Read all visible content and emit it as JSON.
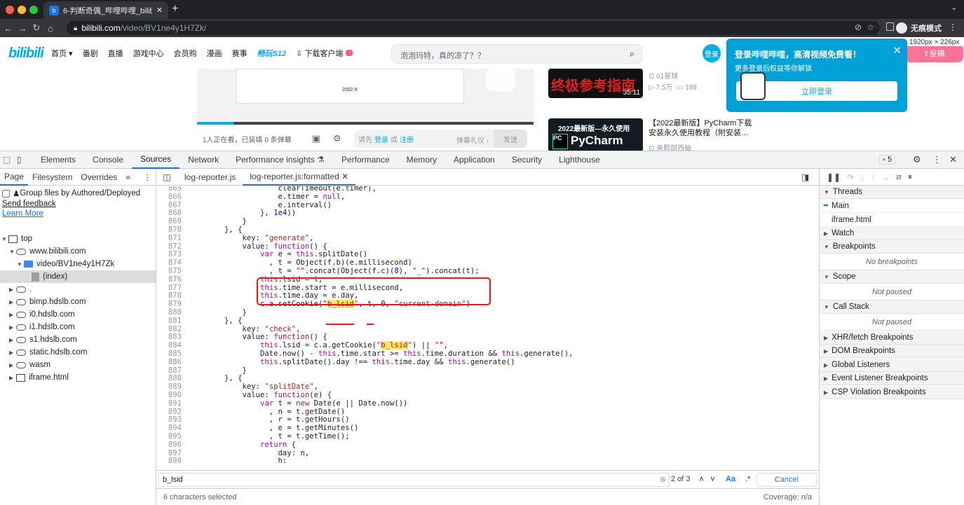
{
  "browser": {
    "tab_title": "6-判断奇偶_哔哩哔哩_bilibili",
    "url_host": "bilibili.com",
    "url_path": "/video/BV1ne4y1H7Zk/",
    "incognito_label": "无痕模式",
    "new_tab_symbol": "+"
  },
  "site": {
    "logo_text": "bilibili",
    "nav": [
      "首页",
      "番剧",
      "直播",
      "游戏中心",
      "会员购",
      "漫画",
      "赛事",
      "畅玩S12",
      "下载客户端"
    ],
    "search_placeholder": "泡泡玛特，真的凉了？？",
    "login_avatar": "登录",
    "upload_label": "投稿",
    "dim_readout": "1920px × 226px",
    "slide_caption": "2002.9",
    "watching": "1人正在看，已装填 0 条弹幕",
    "dm_prefix": "请先",
    "dm_login": "登录",
    "dm_or": "或",
    "dm_register": "注册",
    "dm_etiquette": "弹幕礼仪 ›",
    "dm_send": "发送"
  },
  "recommend": [
    {
      "thumb_text": "终极参考指南",
      "duration": "35:11",
      "title": "",
      "up": "01星球",
      "views": "7.5万",
      "danmaku": "189"
    },
    {
      "thumb_text": "PyCharm",
      "badge": "2022最新版—永久使用",
      "duration": "",
      "title": "【2022最新版】PyCharm下载安装永久使用教程（附安装…",
      "up": "来颗甜西柚"
    }
  ],
  "login_popup": {
    "title": "登录哔哩哔哩，高清视频免费看！",
    "subtitle": "更多登录后权益等你解锁",
    "button": "立即登录",
    "close": "✕"
  },
  "devtools": {
    "tabs": [
      "Elements",
      "Console",
      "Sources",
      "Network",
      "Performance insights",
      "Performance",
      "Memory",
      "Application",
      "Security",
      "Lighthouse"
    ],
    "active_tab": "Sources",
    "issues_count": "5",
    "navigator_tabs": [
      "Page",
      "Filesystem",
      "Overrides"
    ],
    "group_files_label": "Group files by Authored/Deployed",
    "send_feedback": "Send feedback",
    "learn_more": "Learn More",
    "tree": [
      {
        "label": "top",
        "kind": "frame",
        "indent": 0,
        "expanded": true
      },
      {
        "label": "www.bilibili.com",
        "kind": "cloud",
        "indent": 1,
        "expanded": true
      },
      {
        "label": "video/BV1ne4y1H7Zk",
        "kind": "folder",
        "indent": 2,
        "expanded": true
      },
      {
        "label": "(index)",
        "kind": "file",
        "indent": 3,
        "selected": true
      },
      {
        "label": ".",
        "kind": "cloud",
        "indent": 1
      },
      {
        "label": "bimp.hdslb.com",
        "kind": "cloud",
        "indent": 1
      },
      {
        "label": "i0.hdslb.com",
        "kind": "cloud",
        "indent": 1
      },
      {
        "label": "i1.hdslb.com",
        "kind": "cloud",
        "indent": 1
      },
      {
        "label": "s1.hdslb.com",
        "kind": "cloud",
        "indent": 1
      },
      {
        "label": "static.hdslb.com",
        "kind": "cloud",
        "indent": 1
      },
      {
        "label": "wasm",
        "kind": "cloud",
        "indent": 1
      },
      {
        "label": "iframe.html",
        "kind": "frame",
        "indent": 1
      }
    ],
    "editor_tabs": [
      "log-reporter.js",
      "log-reporter.js:formatted"
    ],
    "active_editor_tab": "log-reporter.js:formatted",
    "code": [
      {
        "n": "865",
        "t": "                    clearTimeout(e.timer),"
      },
      {
        "n": "866",
        "t": "                    e.timer = null,"
      },
      {
        "n": "867",
        "t": "                    e.interval()"
      },
      {
        "n": "868",
        "t": "                }, 1e4))"
      },
      {
        "n": "869",
        "t": "            }"
      },
      {
        "n": "870",
        "t": "        }, {"
      },
      {
        "n": "871",
        "t": "            key: \"generate\","
      },
      {
        "n": "872",
        "t": "            value: function() {"
      },
      {
        "n": "873",
        "t": "                var e = this.splitDate()"
      },
      {
        "n": "874",
        "t": "                  , t = Object(f.b)(e.millisecond)"
      },
      {
        "n": "875",
        "t": "                  , t = \"\".concat(Object(f.c)(8), \"_\").concat(t);"
      },
      {
        "n": "876",
        "t": "                this.lsid = t,"
      },
      {
        "n": "877",
        "t": "                this.time.start = e.millisecond,"
      },
      {
        "n": "878",
        "t": "                this.time.day = e.day,"
      },
      {
        "n": "879",
        "t": "                c.a.setCookie(\"b_lsid\", t, 0, \"current-domain\")"
      },
      {
        "n": "880",
        "t": "            }"
      },
      {
        "n": "881",
        "t": "        }, {"
      },
      {
        "n": "882",
        "t": "            key: \"check\","
      },
      {
        "n": "883",
        "t": "            value: function() {"
      },
      {
        "n": "884",
        "t": "                this.lsid = c.a.getCookie(\"b_lsid\") || \"\","
      },
      {
        "n": "885",
        "t": "                Date.now() - this.time.start >= this.time.duration && this.generate(),"
      },
      {
        "n": "886",
        "t": "                this.splitDate().day !== this.time.day && this.generate()"
      },
      {
        "n": "887",
        "t": "            }"
      },
      {
        "n": "888",
        "t": "        }, {"
      },
      {
        "n": "889",
        "t": "            key: \"splitDate\","
      },
      {
        "n": "890",
        "t": "            value: function(e) {"
      },
      {
        "n": "891",
        "t": "                var t = new Date(e || Date.now())"
      },
      {
        "n": "892",
        "t": "                  , n = t.getDate()"
      },
      {
        "n": "893",
        "t": "                  , r = t.getHours()"
      },
      {
        "n": "894",
        "t": "                  , e = t.getMinutes()"
      },
      {
        "n": "895",
        "t": "                  , t = t.getTime();"
      },
      {
        "n": "896",
        "t": "                return {"
      },
      {
        "n": "897",
        "t": "                    day: n,"
      },
      {
        "n": "898",
        "t": "                    h:"
      }
    ],
    "search_query": "b_lsid",
    "search_count": "2 of 3",
    "match_case": "Aa",
    "regex": ".*",
    "cancel": "Cancel",
    "status_selection": "6 characters selected",
    "coverage": "Coverage: n/a",
    "debugger": {
      "threads": "Threads",
      "thread_items": [
        "Main",
        "iframe.html"
      ],
      "watch": "Watch",
      "breakpoints": "Breakpoints",
      "no_breakpoints": "No breakpoints",
      "scope": "Scope",
      "not_paused": "Not paused",
      "call_stack": "Call Stack",
      "call_stack_msg": "Not paused",
      "xhr": "XHR/fetch Breakpoints",
      "dom": "DOM Breakpoints",
      "global": "Global Listeners",
      "event": "Event Listener Breakpoints",
      "csp": "CSP Violation Breakpoints"
    }
  }
}
